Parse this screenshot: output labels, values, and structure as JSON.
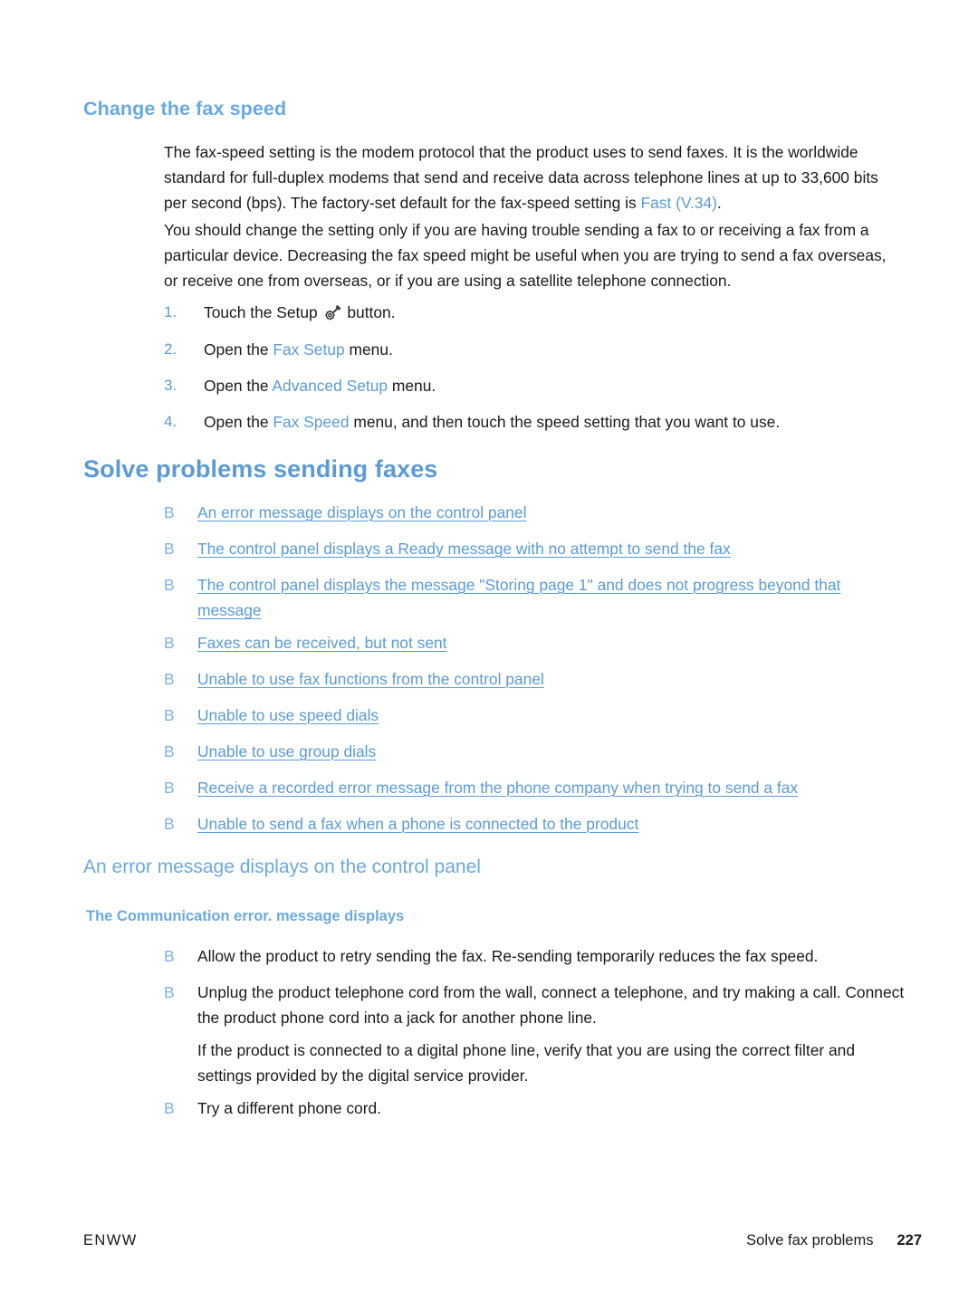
{
  "document": {
    "section_heading": "Change the fax speed",
    "paragraphs": [
      {
        "id": "p1",
        "before": "The fax-speed setting is the modem protocol that the product uses to send faxes. It is the worldwide standard for full-duplex modems that send and receive data across telephone lines at up to 33,600 bits per second (bps). The factory-set default for the fax-speed setting is ",
        "highlight": "Fast (V.34)",
        "after": "."
      },
      {
        "id": "p2",
        "text": "You should change the setting only if you are having trouble sending a fax to or receiving a fax from a particular device. Decreasing the fax speed might be useful when you are trying to send a fax overseas, or receive one from overseas, or if you are using a satellite telephone connection."
      }
    ],
    "steps": [
      {
        "number": "1.",
        "before": "Touch the Setup ",
        "icon": "setup-wrench-gear-icon",
        "highlight": "",
        "after": " button."
      },
      {
        "number": "2.",
        "before": "Open the ",
        "icon": "",
        "highlight": "Fax Setup",
        "after": " menu."
      },
      {
        "number": "3.",
        "before": "Open the ",
        "icon": "",
        "highlight": "Advanced Setup",
        "after": " menu."
      },
      {
        "number": "4.",
        "before": "Open the ",
        "icon": "",
        "highlight": "Fax Speed",
        "after": " menu, and then touch the speed setting that you want to use."
      }
    ],
    "chapter_heading": "Solve problems sending faxes",
    "bullet_marker": "B",
    "toc_links": [
      "An error message displays on the control panel",
      "The control panel displays a Ready message with no attempt to send the fax",
      "The control panel displays the message \"Storing page 1\" and does not progress beyond that message",
      "Faxes can be received, but not sent",
      "Unable to use fax functions from the control panel",
      "Unable to use speed dials",
      "Unable to use group dials",
      "Receive a recorded error message from the phone company when trying to send a fax",
      "Unable to send a fax when a phone is connected to the product"
    ],
    "error_section_heading": "An error message displays on the control panel",
    "error_sub_heading": "The Communication error. message displays",
    "error_bullets": [
      "Allow the product to retry sending the fax. Re-sending temporarily reduces the fax speed.",
      "Unplug the product telephone cord from the wall, connect a telephone, and try making a call. Connect the product phone cord into a jack for another phone line.",
      "Try a different phone cord."
    ],
    "error_subparagraph": "If the product is connected to a digital phone line, verify that you are using the correct filter and settings provided by the digital service provider."
  },
  "footer": {
    "left": "ENWW",
    "section": "Solve fax problems",
    "page_number": "227"
  },
  "colors": {
    "heading_blue": "#5b9bd5",
    "link_blue": "#5b9bd5",
    "bullet_blue": "#7fb3e3",
    "body_black": "#1a1a1a",
    "background": "#ffffff"
  }
}
